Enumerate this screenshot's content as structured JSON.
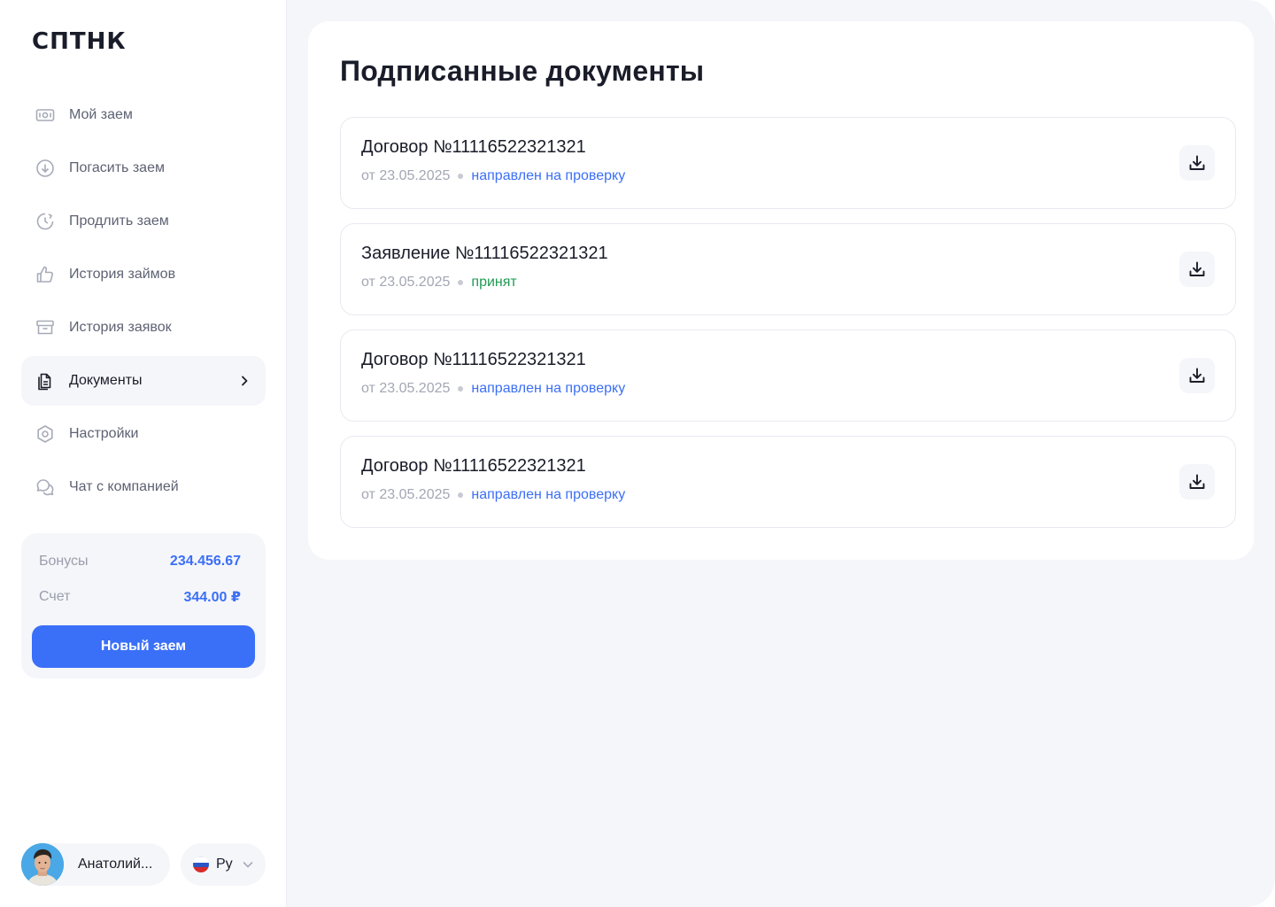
{
  "brand": {
    "logo_text": "СПТНК"
  },
  "sidebar": {
    "items": [
      {
        "label": "Мой заем",
        "icon": "banknote-icon"
      },
      {
        "label": "Погасить заем",
        "icon": "arrow-down-circle-icon"
      },
      {
        "label": "Продлить заем",
        "icon": "clock-refresh-icon"
      },
      {
        "label": "История займов",
        "icon": "thumbs-up-icon"
      },
      {
        "label": "История заявок",
        "icon": "archive-box-icon"
      },
      {
        "label": "Документы",
        "icon": "document-icon",
        "active": true
      },
      {
        "label": "Настройки",
        "icon": "gear-hexagon-icon"
      },
      {
        "label": "Чат с компанией",
        "icon": "chat-bubbles-icon"
      }
    ],
    "balance": {
      "bonus_label": "Бонусы",
      "bonus_value": "234.456.67",
      "account_label": "Счет",
      "account_value": "344.00 ₽",
      "new_loan_label": "Новый заем"
    },
    "user": {
      "name": "Анатолий..."
    },
    "language": {
      "label": "Ру"
    }
  },
  "main": {
    "title": "Подписанные документы",
    "documents": [
      {
        "title": "Договор №11116522321321",
        "date": "от 23.05.2025",
        "status": "направлен на проверку",
        "status_type": "review"
      },
      {
        "title": "Заявление №11116522321321",
        "date": "от 23.05.2025",
        "status": "принят",
        "status_type": "accepted"
      },
      {
        "title": "Договор №11116522321321",
        "date": "от 23.05.2025",
        "status": "направлен на проверку",
        "status_type": "review"
      },
      {
        "title": "Договор №11116522321321",
        "date": "от 23.05.2025",
        "status": "направлен на проверку",
        "status_type": "review"
      }
    ]
  },
  "colors": {
    "accent": "#3a6ff8",
    "status_review": "#3b6ff5",
    "status_accepted": "#1f9a53",
    "background": "#f5f6fa"
  }
}
